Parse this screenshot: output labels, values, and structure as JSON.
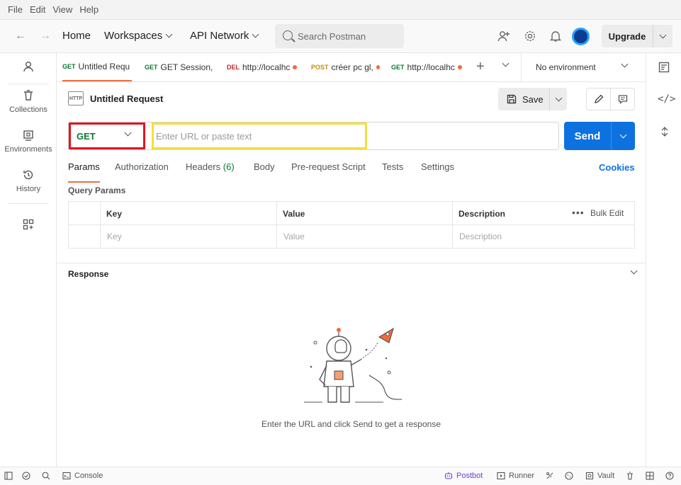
{
  "menu": [
    "File",
    "Edit",
    "View",
    "Help"
  ],
  "topbar": {
    "home": "Home",
    "workspaces": "Workspaces",
    "api_network": "API Network",
    "search_placeholder": "Search Postman",
    "upgrade": "Upgrade"
  },
  "sidebar": {
    "items": [
      {
        "label": "",
        "icon": "user-icon"
      },
      {
        "label": "Collections",
        "icon": "trash-bin-icon"
      },
      {
        "label": "Environments",
        "icon": "environment-icon"
      },
      {
        "label": "History",
        "icon": "history-icon"
      },
      {
        "label": "",
        "icon": "add-apps-icon"
      }
    ]
  },
  "tabs": [
    {
      "method": "GET",
      "label": "Untitled Requ",
      "method_color": "#0a7a2f",
      "unsaved": false
    },
    {
      "method": "GET",
      "label": "GET Session,",
      "method_color": "#0a7a2f",
      "unsaved": true
    },
    {
      "method": "DEL",
      "label": "http://localhc",
      "method_color": "#c0282d",
      "unsaved": true
    },
    {
      "method": "POST",
      "label": "créer pc gl,",
      "method_color": "#c58b0b",
      "unsaved": true
    },
    {
      "method": "GET",
      "label": "http://localhc",
      "method_color": "#0a7a2f",
      "unsaved": true
    }
  ],
  "environment": "No environment",
  "request": {
    "title": "Untitled Request",
    "http_badge": "HTTP",
    "save": "Save",
    "method": "GET",
    "url_placeholder": "Enter URL or paste text",
    "send": "Send"
  },
  "subtabs": {
    "params": "Params",
    "authorization": "Authorization",
    "headers": "Headers",
    "headers_count": "(6)",
    "body": "Body",
    "prerequest": "Pre-request Script",
    "tests": "Tests",
    "settings": "Settings",
    "cookies": "Cookies"
  },
  "query_params": {
    "title": "Query Params",
    "columns": [
      "Key",
      "Value",
      "Description"
    ],
    "placeholders": [
      "Key",
      "Value",
      "Description"
    ],
    "bulk_edit": "Bulk Edit"
  },
  "response": {
    "title": "Response",
    "message": "Enter the URL and click Send to get a response"
  },
  "statusbar": {
    "console": "Console",
    "postbot": "Postbot",
    "runner": "Runner",
    "vault": "Vault"
  },
  "colors": {
    "accent": "#f26b3a",
    "send_blue": "#0d72e0",
    "method_highlight": "#e4141e",
    "url_highlight": "#f2e040"
  }
}
